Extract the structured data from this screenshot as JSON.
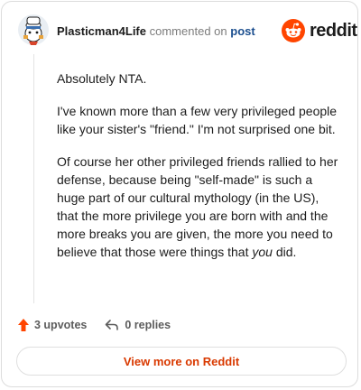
{
  "comment": {
    "username": "Plasticman4Life",
    "action_text": "commented on",
    "post_link": "post",
    "brand": "reddit",
    "paragraphs": [
      "Absolutely NTA.",
      "I've known more than a few very privileged people like your sister's \"friend.\" I'm not surprised one bit."
    ],
    "paragraph3_before_emphasis": "Of course her other privileged friends rallied to her defense, because being \"self-made\" is such a huge part of our cultural mythology (in the US), that the more privilege you are born with and the more breaks you are given, the more you need to believe that those were things that",
    "paragraph3_emphasis": "you",
    "paragraph3_after_emphasis": "did."
  },
  "footer": {
    "upvotes": "3 upvotes",
    "replies": "0 replies",
    "view_more": "View more on Reddit"
  },
  "colors": {
    "upvote_orange": "#ff4500",
    "link_blue": "#1c4f8f",
    "view_more_orange": "#d93900"
  },
  "icons": [
    "avatar-icon",
    "reddit-logo-icon",
    "upvote-arrow-icon",
    "reply-arrow-icon"
  ]
}
